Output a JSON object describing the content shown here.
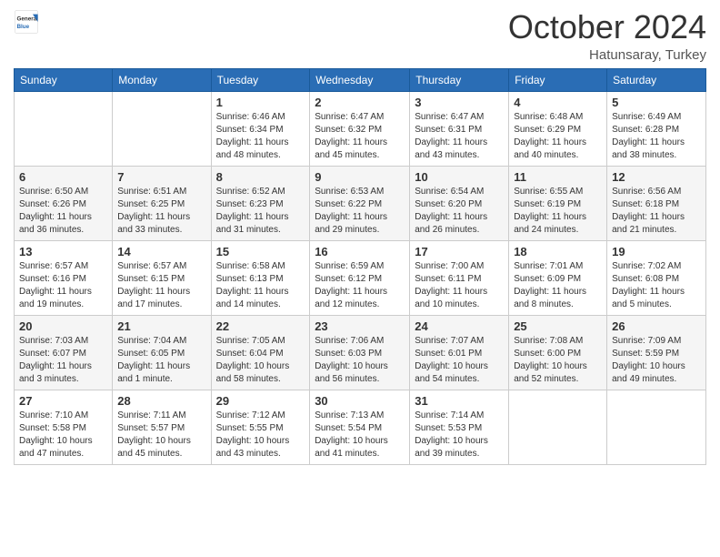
{
  "logo": {
    "general": "General",
    "blue": "Blue"
  },
  "header": {
    "month": "October 2024",
    "location": "Hatunsaray, Turkey"
  },
  "weekdays": [
    "Sunday",
    "Monday",
    "Tuesday",
    "Wednesday",
    "Thursday",
    "Friday",
    "Saturday"
  ],
  "weeks": [
    [
      {
        "day": "",
        "info": ""
      },
      {
        "day": "",
        "info": ""
      },
      {
        "day": "1",
        "info": "Sunrise: 6:46 AM\nSunset: 6:34 PM\nDaylight: 11 hours and 48 minutes."
      },
      {
        "day": "2",
        "info": "Sunrise: 6:47 AM\nSunset: 6:32 PM\nDaylight: 11 hours and 45 minutes."
      },
      {
        "day": "3",
        "info": "Sunrise: 6:47 AM\nSunset: 6:31 PM\nDaylight: 11 hours and 43 minutes."
      },
      {
        "day": "4",
        "info": "Sunrise: 6:48 AM\nSunset: 6:29 PM\nDaylight: 11 hours and 40 minutes."
      },
      {
        "day": "5",
        "info": "Sunrise: 6:49 AM\nSunset: 6:28 PM\nDaylight: 11 hours and 38 minutes."
      }
    ],
    [
      {
        "day": "6",
        "info": "Sunrise: 6:50 AM\nSunset: 6:26 PM\nDaylight: 11 hours and 36 minutes."
      },
      {
        "day": "7",
        "info": "Sunrise: 6:51 AM\nSunset: 6:25 PM\nDaylight: 11 hours and 33 minutes."
      },
      {
        "day": "8",
        "info": "Sunrise: 6:52 AM\nSunset: 6:23 PM\nDaylight: 11 hours and 31 minutes."
      },
      {
        "day": "9",
        "info": "Sunrise: 6:53 AM\nSunset: 6:22 PM\nDaylight: 11 hours and 29 minutes."
      },
      {
        "day": "10",
        "info": "Sunrise: 6:54 AM\nSunset: 6:20 PM\nDaylight: 11 hours and 26 minutes."
      },
      {
        "day": "11",
        "info": "Sunrise: 6:55 AM\nSunset: 6:19 PM\nDaylight: 11 hours and 24 minutes."
      },
      {
        "day": "12",
        "info": "Sunrise: 6:56 AM\nSunset: 6:18 PM\nDaylight: 11 hours and 21 minutes."
      }
    ],
    [
      {
        "day": "13",
        "info": "Sunrise: 6:57 AM\nSunset: 6:16 PM\nDaylight: 11 hours and 19 minutes."
      },
      {
        "day": "14",
        "info": "Sunrise: 6:57 AM\nSunset: 6:15 PM\nDaylight: 11 hours and 17 minutes."
      },
      {
        "day": "15",
        "info": "Sunrise: 6:58 AM\nSunset: 6:13 PM\nDaylight: 11 hours and 14 minutes."
      },
      {
        "day": "16",
        "info": "Sunrise: 6:59 AM\nSunset: 6:12 PM\nDaylight: 11 hours and 12 minutes."
      },
      {
        "day": "17",
        "info": "Sunrise: 7:00 AM\nSunset: 6:11 PM\nDaylight: 11 hours and 10 minutes."
      },
      {
        "day": "18",
        "info": "Sunrise: 7:01 AM\nSunset: 6:09 PM\nDaylight: 11 hours and 8 minutes."
      },
      {
        "day": "19",
        "info": "Sunrise: 7:02 AM\nSunset: 6:08 PM\nDaylight: 11 hours and 5 minutes."
      }
    ],
    [
      {
        "day": "20",
        "info": "Sunrise: 7:03 AM\nSunset: 6:07 PM\nDaylight: 11 hours and 3 minutes."
      },
      {
        "day": "21",
        "info": "Sunrise: 7:04 AM\nSunset: 6:05 PM\nDaylight: 11 hours and 1 minute."
      },
      {
        "day": "22",
        "info": "Sunrise: 7:05 AM\nSunset: 6:04 PM\nDaylight: 10 hours and 58 minutes."
      },
      {
        "day": "23",
        "info": "Sunrise: 7:06 AM\nSunset: 6:03 PM\nDaylight: 10 hours and 56 minutes."
      },
      {
        "day": "24",
        "info": "Sunrise: 7:07 AM\nSunset: 6:01 PM\nDaylight: 10 hours and 54 minutes."
      },
      {
        "day": "25",
        "info": "Sunrise: 7:08 AM\nSunset: 6:00 PM\nDaylight: 10 hours and 52 minutes."
      },
      {
        "day": "26",
        "info": "Sunrise: 7:09 AM\nSunset: 5:59 PM\nDaylight: 10 hours and 49 minutes."
      }
    ],
    [
      {
        "day": "27",
        "info": "Sunrise: 7:10 AM\nSunset: 5:58 PM\nDaylight: 10 hours and 47 minutes."
      },
      {
        "day": "28",
        "info": "Sunrise: 7:11 AM\nSunset: 5:57 PM\nDaylight: 10 hours and 45 minutes."
      },
      {
        "day": "29",
        "info": "Sunrise: 7:12 AM\nSunset: 5:55 PM\nDaylight: 10 hours and 43 minutes."
      },
      {
        "day": "30",
        "info": "Sunrise: 7:13 AM\nSunset: 5:54 PM\nDaylight: 10 hours and 41 minutes."
      },
      {
        "day": "31",
        "info": "Sunrise: 7:14 AM\nSunset: 5:53 PM\nDaylight: 10 hours and 39 minutes."
      },
      {
        "day": "",
        "info": ""
      },
      {
        "day": "",
        "info": ""
      }
    ]
  ]
}
